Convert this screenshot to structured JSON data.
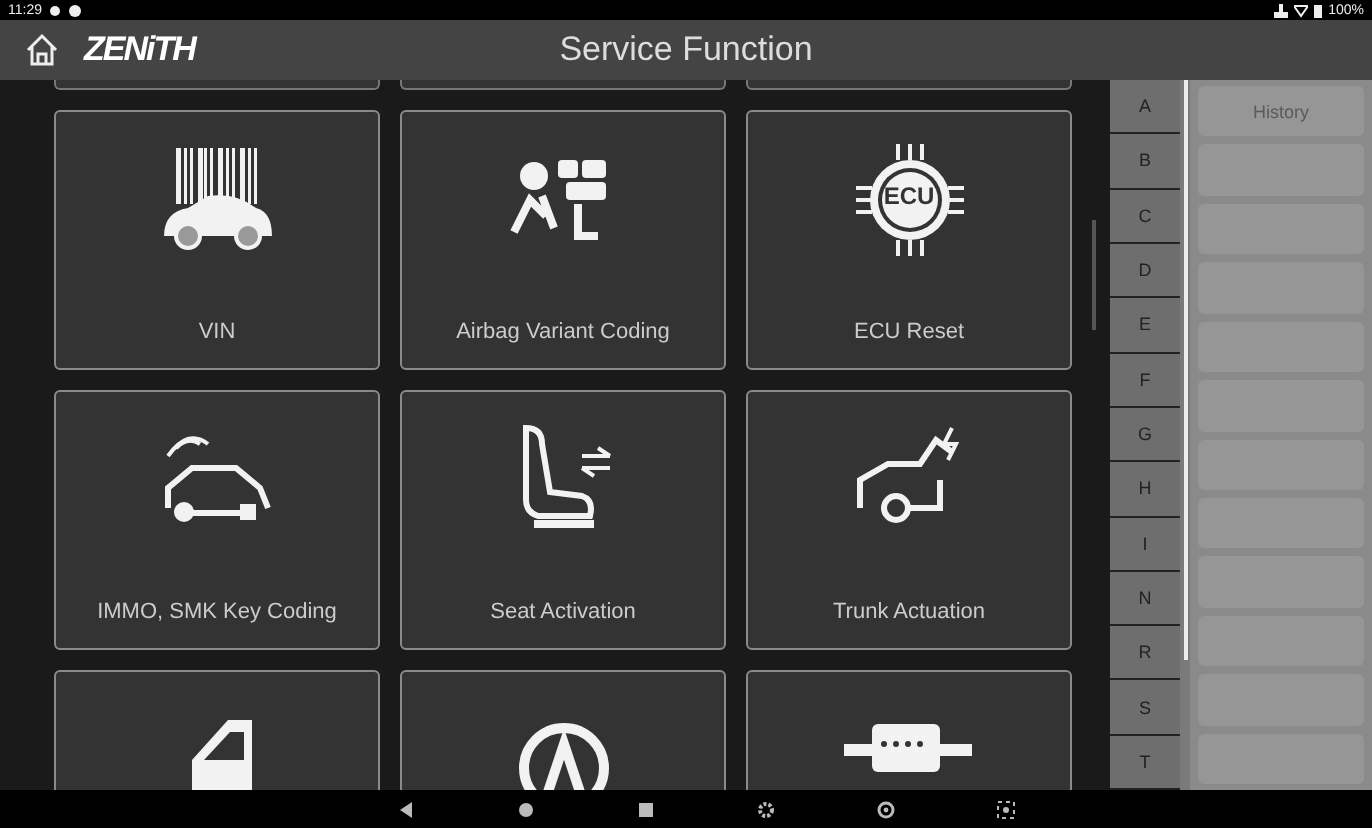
{
  "status_bar": {
    "time": "11:29",
    "battery": "100%"
  },
  "header": {
    "logo": "ZENiTH",
    "title": "Service Function"
  },
  "tiles": [
    {
      "kind": "barcode-car",
      "label": "VIN"
    },
    {
      "kind": "airbag",
      "label": "Airbag Variant Coding"
    },
    {
      "kind": "ecu",
      "badge": "ECU",
      "label": "ECU Reset"
    },
    {
      "kind": "key-car",
      "label": "IMMO, SMK Key Coding"
    },
    {
      "kind": "seat",
      "label": "Seat Activation"
    },
    {
      "kind": "trunk",
      "label": "Trunk Actuation"
    },
    {
      "kind": "window"
    },
    {
      "kind": "circle-a"
    },
    {
      "kind": "exhaust"
    }
  ],
  "index_letters": [
    "A",
    "B",
    "C",
    "D",
    "E",
    "F",
    "G",
    "H",
    "I",
    "N",
    "R",
    "S",
    "T"
  ],
  "history": {
    "title": "History"
  }
}
